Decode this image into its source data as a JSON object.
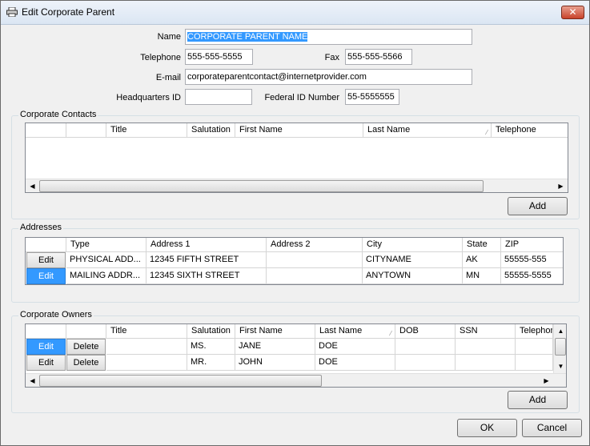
{
  "window": {
    "title": "Edit Corporate Parent",
    "close_label": "✕"
  },
  "form": {
    "name_label": "Name",
    "name_value": "CORPORATE PARENT NAME",
    "telephone_label": "Telephone",
    "telephone_value": "555-555-5555",
    "fax_label": "Fax",
    "fax_value": "555-555-5566",
    "email_label": "E-mail",
    "email_value": "corporateparentcontact@internetprovider.com",
    "hq_label": "Headquarters ID",
    "hq_value": "",
    "federal_label": "Federal ID Number",
    "federal_value": "55-5555555"
  },
  "contacts": {
    "title": "Corporate Contacts",
    "columns": [
      "Title",
      "Salutation",
      "First Name",
      "Last Name",
      "Telephone"
    ],
    "add_label": "Add"
  },
  "addresses": {
    "title": "Addresses",
    "columns": [
      "Type",
      "Address 1",
      "Address 2",
      "City",
      "State",
      "ZIP"
    ],
    "edit_label": "Edit",
    "rows": [
      {
        "type": "PHYSICAL ADD...",
        "address1": "12345 FIFTH STREET",
        "address2": "",
        "city": "CITYNAME",
        "state": "AK",
        "zip": "55555-555"
      },
      {
        "type": "MAILING ADDR...",
        "address1": "12345 SIXTH STREET",
        "address2": "",
        "city": "ANYTOWN",
        "state": "MN",
        "zip": "55555-5555"
      }
    ]
  },
  "owners": {
    "title": "Corporate Owners",
    "columns": [
      "Title",
      "Salutation",
      "First Name",
      "Last Name",
      "DOB",
      "SSN",
      "Telephon"
    ],
    "edit_label": "Edit",
    "delete_label": "Delete",
    "rows": [
      {
        "title": "",
        "salutation": "MS.",
        "first": "JANE",
        "last": "DOE",
        "dob": "",
        "ssn": "",
        "tel": ""
      },
      {
        "title": "",
        "salutation": "MR.",
        "first": "JOHN",
        "last": "DOE",
        "dob": "",
        "ssn": "",
        "tel": ""
      }
    ],
    "add_label": "Add"
  },
  "footer": {
    "ok_label": "OK",
    "cancel_label": "Cancel"
  }
}
